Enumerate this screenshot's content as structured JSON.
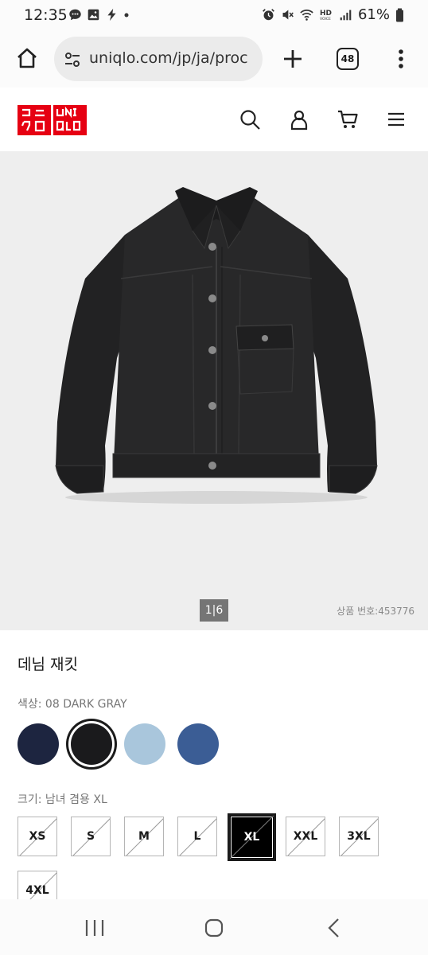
{
  "status_bar": {
    "time": "12:35",
    "left_icons": [
      "chat-bubble-icon",
      "image-icon",
      "lightning-icon",
      "dot-icon"
    ],
    "right_icons": [
      "alarm-icon",
      "mute-icon",
      "wifi-icon",
      "hd-voice-icon",
      "signal-icon",
      "battery-icon"
    ],
    "battery": "61%"
  },
  "browser": {
    "url": "uniqlo.com/jp/ja/proc",
    "tab_count": "48"
  },
  "site": {
    "logo_top": "ユニ\nクロ",
    "logo_bottom": "UNI\nQLO",
    "brand_color": "#e60012"
  },
  "product": {
    "image_counter": "1|6",
    "product_code": "상품 번호:453776",
    "name": "데님 재킷",
    "color_label": "색상: 08 DARK GRAY",
    "colors": [
      {
        "name": "navy",
        "hex": "#1d2540",
        "selected": false
      },
      {
        "name": "08 DARK GRAY",
        "hex": "#1a1a1c",
        "selected": true
      },
      {
        "name": "light blue",
        "hex": "#a9c6dc",
        "selected": false
      },
      {
        "name": "blue",
        "hex": "#3b5d95",
        "selected": false
      }
    ],
    "size_label": "크기: 남녀 겸용 XL",
    "sizes": [
      {
        "label": "XS",
        "selected": false
      },
      {
        "label": "S",
        "selected": false
      },
      {
        "label": "M",
        "selected": false
      },
      {
        "label": "L",
        "selected": false
      },
      {
        "label": "XL",
        "selected": true
      },
      {
        "label": "XXL",
        "selected": false
      },
      {
        "label": "3XL",
        "selected": false
      },
      {
        "label": "4XL",
        "selected": false
      }
    ]
  },
  "nav": {
    "buttons": [
      "recent-apps-icon",
      "home-icon",
      "back-icon"
    ]
  }
}
